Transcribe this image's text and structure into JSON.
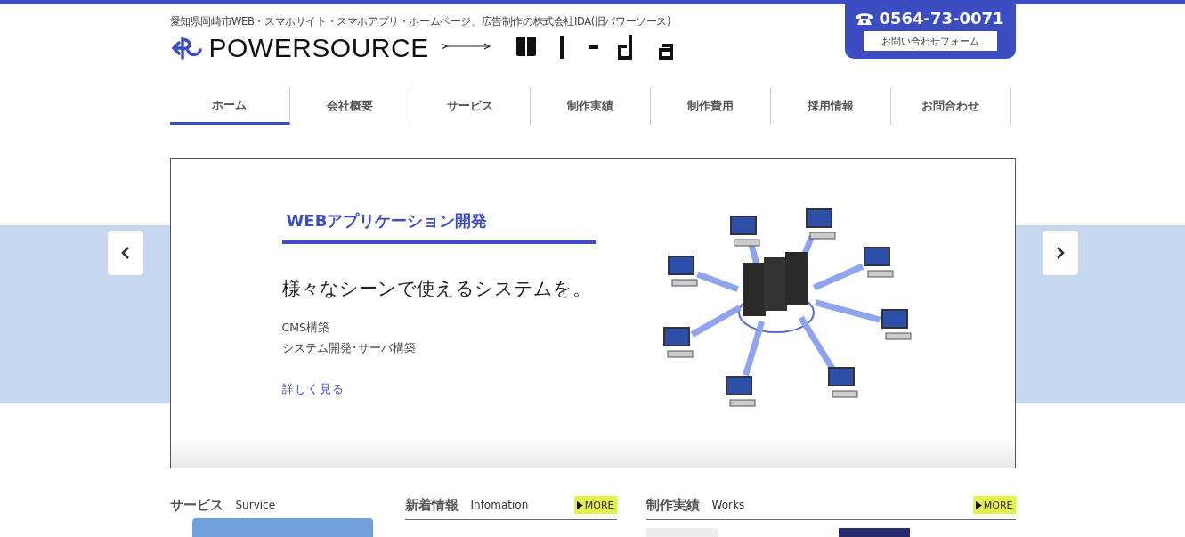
{
  "header": {
    "tagline": "愛知県岡崎市WEB・スマホサイト・スマホアプリ・ホームページ、広告制作の株式会社IDA(旧パワーソース)",
    "logo_text": "POWERSOURCE",
    "phone": "0564-73-0071",
    "contact_button": "お問い合わせフォーム"
  },
  "nav": [
    {
      "label": "ホーム",
      "selected": true
    },
    {
      "label": "会社概要",
      "selected": false
    },
    {
      "label": "サービス",
      "selected": false
    },
    {
      "label": "制作実績",
      "selected": false
    },
    {
      "label": "制作費用",
      "selected": false
    },
    {
      "label": "採用情報",
      "selected": false
    },
    {
      "label": "お問合わせ",
      "selected": false
    }
  ],
  "slide": {
    "heading": "WEBアプリケーション開発",
    "catch": "様々なシーンで使えるシステムを。",
    "lines": [
      "CMS構築",
      "システム開発･サーバ構築"
    ],
    "link": "詳しく見る"
  },
  "sections": [
    {
      "kind": "service",
      "title": "サービス",
      "subtitle": "Survice"
    },
    {
      "kind": "news",
      "title": "新着情報",
      "subtitle": "Infomation",
      "more": "MORE"
    },
    {
      "kind": "works",
      "title": "制作実績",
      "subtitle": "Works",
      "more": "MORE"
    }
  ]
}
